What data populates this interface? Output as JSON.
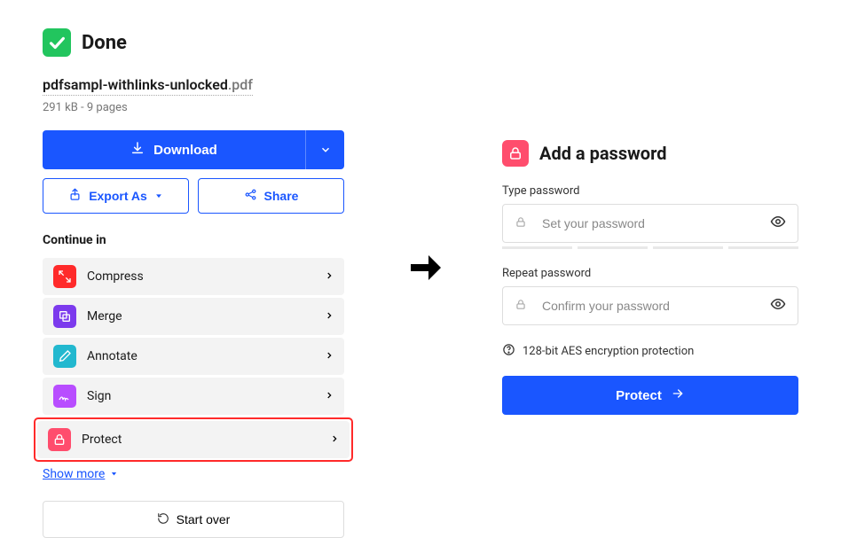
{
  "left": {
    "done_label": "Done",
    "filename_base": "pdfsampl-withlinks-unlocked",
    "filename_ext": ".pdf",
    "meta": "291 kB - 9 pages",
    "download_label": "Download",
    "export_label": "Export As",
    "share_label": "Share",
    "continue_label": "Continue in",
    "tools": {
      "compress": {
        "label": "Compress",
        "color": "#ff2a2a"
      },
      "merge": {
        "label": "Merge",
        "color": "#7c3aed"
      },
      "annotate": {
        "label": "Annotate",
        "color": "#22b8cf"
      },
      "sign": {
        "label": "Sign",
        "color": "#b84dff"
      },
      "protect": {
        "label": "Protect",
        "color": "#ff4d6d"
      }
    },
    "show_more": "Show more",
    "start_over": "Start over"
  },
  "right": {
    "title": "Add a password",
    "type_label": "Type password",
    "type_placeholder": "Set your password",
    "repeat_label": "Repeat password",
    "repeat_placeholder": "Confirm your password",
    "info": "128-bit AES encryption protection",
    "button": "Protect"
  }
}
